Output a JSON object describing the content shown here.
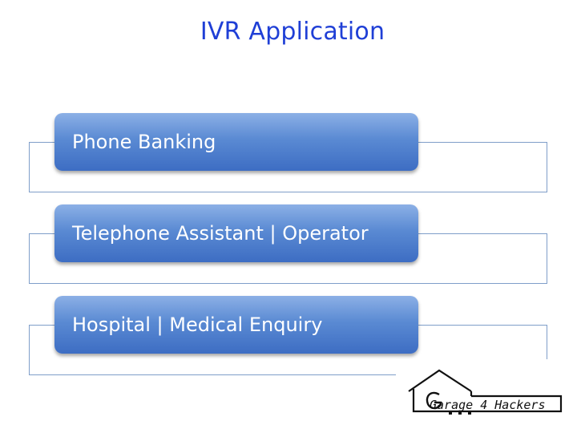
{
  "slide": {
    "title": "IVR Application"
  },
  "list_items": [
    {
      "label": "Phone Banking"
    },
    {
      "label": "Telephone Assistant | Operator"
    },
    {
      "label": "Hospital | Medical Enquiry"
    }
  ],
  "logo": {
    "text": "Garage 4 Hackers",
    "icon": "house-icon"
  },
  "colors": {
    "title": "#1f3fd6",
    "pill_top": "#8cb0e6",
    "pill_bottom": "#3d6dc3",
    "frame_border": "#7f9ec9"
  }
}
